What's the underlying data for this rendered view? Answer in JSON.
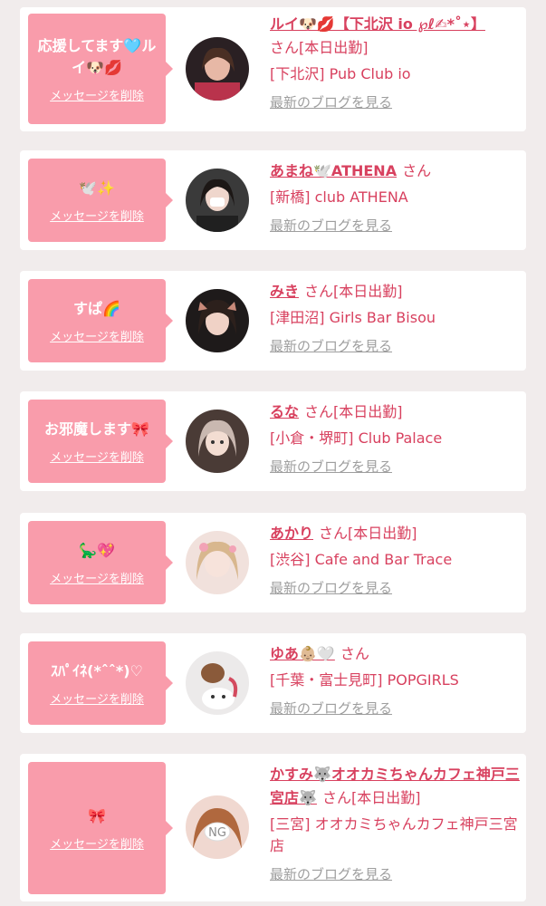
{
  "cards": [
    {
      "message": "応援してます🩵ルイ🐶💋",
      "delete_label": "メッセージを削除",
      "name": "ルイ🐶💋【下北沢 io ℘ℓ✍*˚⋆】",
      "san": "さん",
      "status": "[本日出勤]",
      "shop": "[下北沢] Pub Club io",
      "blog_label": "最新のブログを見る"
    },
    {
      "message": "🕊️✨",
      "delete_label": "メッセージを削除",
      "name": "あまね🕊️ATHENA",
      "san": "さん",
      "status": "",
      "shop": "[新橋] club ATHENA",
      "blog_label": "最新のブログを見る"
    },
    {
      "message": "すぱ🌈",
      "delete_label": "メッセージを削除",
      "name": "みき",
      "san": "さん",
      "status": "[本日出勤]",
      "shop": "[津田沼] Girls Bar Bisou",
      "blog_label": "最新のブログを見る"
    },
    {
      "message": "お邪魔します🎀",
      "delete_label": "メッセージを削除",
      "name": "るな",
      "san": "さん",
      "status": "[本日出勤]",
      "shop": "[小倉・堺町] Club Palace",
      "blog_label": "最新のブログを見る"
    },
    {
      "message": "🦕💖",
      "delete_label": "メッセージを削除",
      "name": "あかり",
      "san": "さん",
      "status": "[本日出勤]",
      "shop": "[渋谷] Cafe and Bar Trace",
      "blog_label": "最新のブログを見る"
    },
    {
      "message": "ｽﾊﾟｲﾈ(*ˆˆ*)♡",
      "delete_label": "メッセージを削除",
      "name": "ゆあ👶🏼🤍",
      "san": "さん",
      "status": "",
      "shop": "[千葉・富士見町] POPGIRLS",
      "blog_label": "最新のブログを見る"
    },
    {
      "message": "🎀",
      "delete_label": "メッセージを削除",
      "name": "かすみ🐺オオカミちゃんカフェ神戸三宮店🐺",
      "san": "さん",
      "status": "[本日出勤]",
      "shop": "[三宮] オオカミちゃんカフェ神戸三宮店",
      "blog_label": "最新のブログを見る"
    }
  ],
  "colors": {
    "page_bg": "#f1ecec",
    "card_bg": "#ffffff",
    "bubble_bg": "#f99cab",
    "accent": "#d8415f",
    "link_gray": "#9e9e9e"
  },
  "avatar_sticker_text": "NG"
}
